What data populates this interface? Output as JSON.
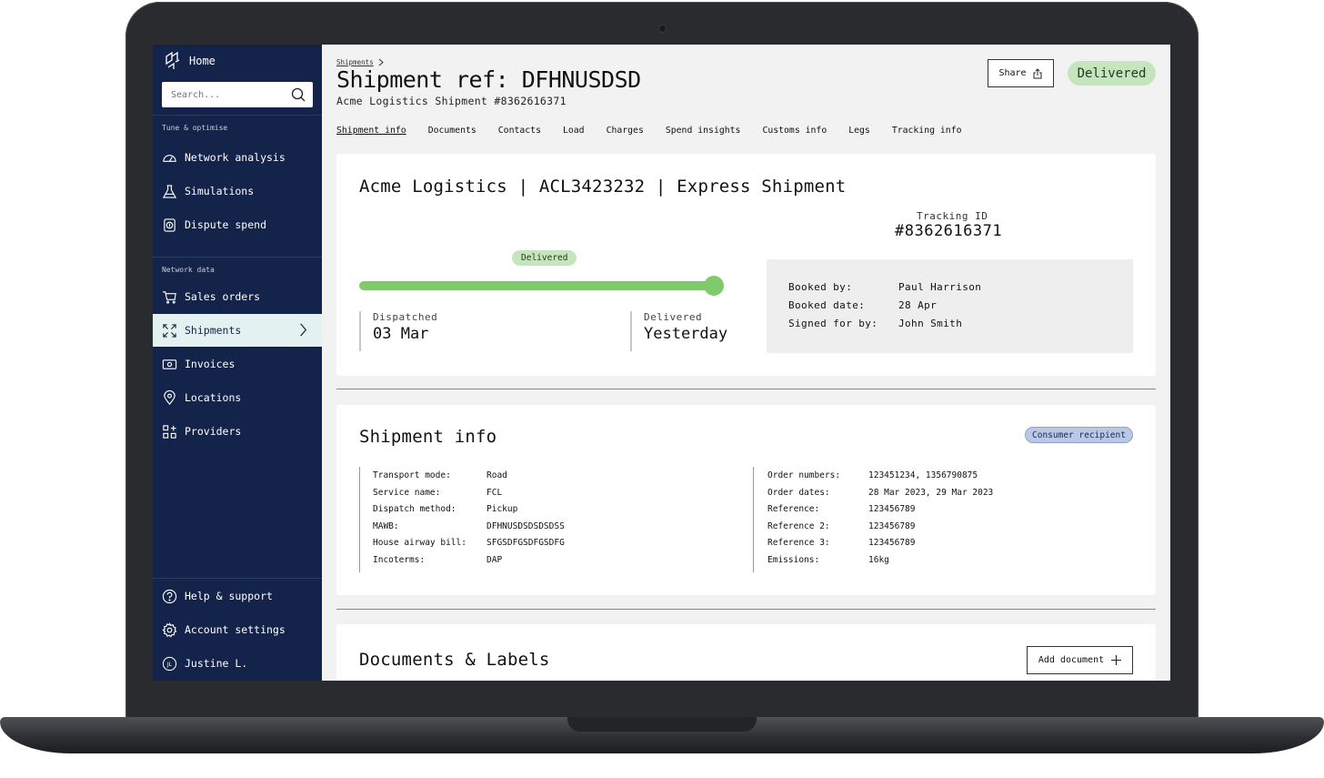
{
  "sidebar": {
    "home_label": "Home",
    "search_placeholder": "Search...",
    "section_tune": "Tune & optimise",
    "section_network": "Network data",
    "items": [
      {
        "label": "Network analysis",
        "icon": "gauge-icon"
      },
      {
        "label": "Simulations",
        "icon": "flask-icon"
      },
      {
        "label": "Dispute spend",
        "icon": "dispute-icon"
      },
      {
        "label": "Sales orders",
        "icon": "cart-icon"
      },
      {
        "label": "Shipments",
        "icon": "expand-arrows-icon",
        "active": true
      },
      {
        "label": "Invoices",
        "icon": "invoice-icon"
      },
      {
        "label": "Locations",
        "icon": "location-pin-icon"
      },
      {
        "label": "Providers",
        "icon": "providers-icon"
      }
    ],
    "footer": [
      {
        "label": "Help & support",
        "icon": "help-icon"
      },
      {
        "label": "Account settings",
        "icon": "gear-icon"
      },
      {
        "label": "Justine L.",
        "icon": "avatar-icon",
        "initials": "JL"
      }
    ]
  },
  "header": {
    "breadcrumb": "Shipments",
    "title": "Shipment ref: DFHNUSDSD",
    "subtitle": "Acme Logistics Shipment #8362616371",
    "share_label": "Share",
    "status": "Delivered"
  },
  "tabs": [
    "Shipment info",
    "Documents",
    "Contacts",
    "Load",
    "Charges",
    "Spend insights",
    "Customs info",
    "Legs",
    "Tracking info"
  ],
  "summary": {
    "title": "Acme Logistics | ACL3423232 | Express Shipment",
    "tracking_label": "Tracking ID",
    "tracking_id": "#8362616371",
    "progress_status": "Delivered",
    "progress": 1.0,
    "dispatched_label": "Dispatched",
    "dispatched_value": "03 Mar",
    "delivered_label": "Delivered",
    "delivered_value": "Yesterday",
    "booked": [
      {
        "k": "Booked by:",
        "v": "Paul Harrison"
      },
      {
        "k": "Booked date:",
        "v": "28 Apr"
      },
      {
        "k": "Signed for by:",
        "v": "John Smith"
      }
    ]
  },
  "shipment_info": {
    "title": "Shipment info",
    "badge": "Consumer recipient",
    "left": [
      {
        "k": "Transport mode:",
        "v": "Road"
      },
      {
        "k": "Service name:",
        "v": "FCL"
      },
      {
        "k": "Dispatch method:",
        "v": "Pickup"
      },
      {
        "k": "MAWB:",
        "v": "DFHNUSDSDSDSDSS"
      },
      {
        "k": "House airway bill:",
        "v": "SFGSDFGSDFGSDFG"
      },
      {
        "k": "Incoterms:",
        "v": "DAP"
      }
    ],
    "right": [
      {
        "k": "Order numbers:",
        "v": "123451234, 1356790875"
      },
      {
        "k": "Order dates:",
        "v": "28 Mar 2023, 29 Mar 2023"
      },
      {
        "k": "Reference:",
        "v": "123456789"
      },
      {
        "k": "Reference 2:",
        "v": "123456789"
      },
      {
        "k": "Reference 3:",
        "v": "123456789"
      },
      {
        "k": "Emissions:",
        "v": "16kg"
      }
    ]
  },
  "documents": {
    "title": "Documents & Labels",
    "add_label": "Add document"
  },
  "colors": {
    "sidebar_bg": "#14234a",
    "active_item_bg": "#e3f1f1",
    "delivered_green": "#c5e6bd",
    "progress_green": "#7fcb6c",
    "badge_blue": "#b9c8e6"
  }
}
